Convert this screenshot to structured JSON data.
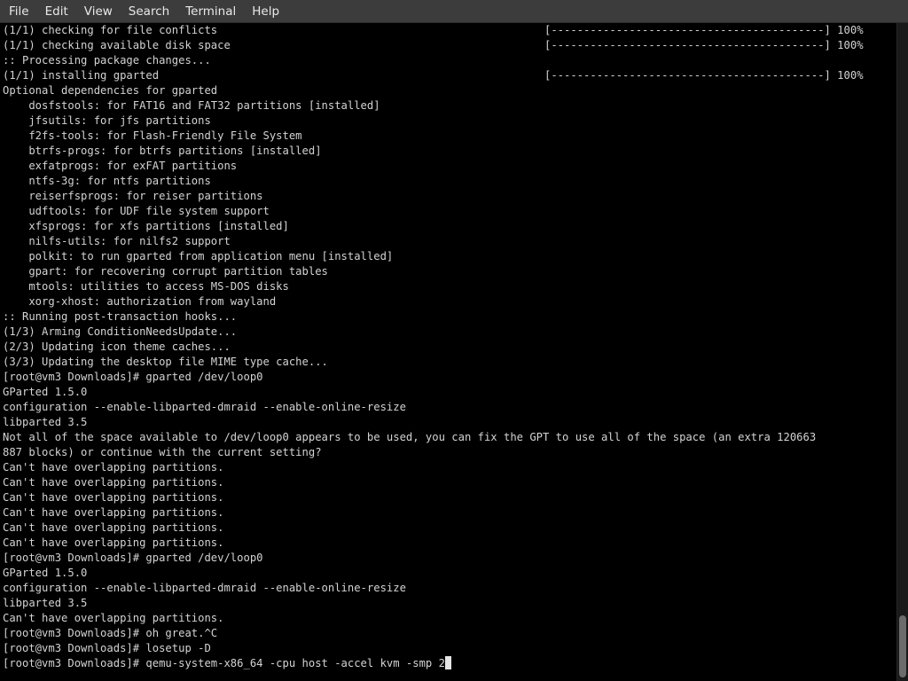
{
  "menu": [
    "File",
    "Edit",
    "View",
    "Search",
    "Terminal",
    "Help"
  ],
  "lines": [
    {
      "text": "(1/1) checking for file conflicts",
      "right": "[------------------------------------------] 100%"
    },
    {
      "text": "(1/1) checking available disk space",
      "right": "[------------------------------------------] 100%"
    },
    {
      "text": ":: Processing package changes..."
    },
    {
      "text": "(1/1) installing gparted",
      "right": "[------------------------------------------] 100%"
    },
    {
      "text": "Optional dependencies for gparted"
    },
    {
      "text": "    dosfstools: for FAT16 and FAT32 partitions [installed]"
    },
    {
      "text": "    jfsutils: for jfs partitions"
    },
    {
      "text": "    f2fs-tools: for Flash-Friendly File System"
    },
    {
      "text": "    btrfs-progs: for btrfs partitions [installed]"
    },
    {
      "text": "    exfatprogs: for exFAT partitions"
    },
    {
      "text": "    ntfs-3g: for ntfs partitions"
    },
    {
      "text": "    reiserfsprogs: for reiser partitions"
    },
    {
      "text": "    udftools: for UDF file system support"
    },
    {
      "text": "    xfsprogs: for xfs partitions [installed]"
    },
    {
      "text": "    nilfs-utils: for nilfs2 support"
    },
    {
      "text": "    polkit: to run gparted from application menu [installed]"
    },
    {
      "text": "    gpart: for recovering corrupt partition tables"
    },
    {
      "text": "    mtools: utilities to access MS-DOS disks"
    },
    {
      "text": "    xorg-xhost: authorization from wayland"
    },
    {
      "text": ":: Running post-transaction hooks..."
    },
    {
      "text": "(1/3) Arming ConditionNeedsUpdate..."
    },
    {
      "text": "(2/3) Updating icon theme caches..."
    },
    {
      "text": "(3/3) Updating the desktop file MIME type cache..."
    },
    {
      "text": "[root@vm3 Downloads]# gparted /dev/loop0"
    },
    {
      "text": "GParted 1.5.0"
    },
    {
      "text": "configuration --enable-libparted-dmraid --enable-online-resize"
    },
    {
      "text": "libparted 3.5"
    },
    {
      "text": "Not all of the space available to /dev/loop0 appears to be used, you can fix the GPT to use all of the space (an extra 120663"
    },
    {
      "text": "887 blocks) or continue with the current setting?"
    },
    {
      "text": "Can't have overlapping partitions."
    },
    {
      "text": "Can't have overlapping partitions."
    },
    {
      "text": "Can't have overlapping partitions."
    },
    {
      "text": "Can't have overlapping partitions."
    },
    {
      "text": "Can't have overlapping partitions."
    },
    {
      "text": "Can't have overlapping partitions."
    },
    {
      "text": "[root@vm3 Downloads]# gparted /dev/loop0"
    },
    {
      "text": "GParted 1.5.0"
    },
    {
      "text": "configuration --enable-libparted-dmraid --enable-online-resize"
    },
    {
      "text": "libparted 3.5"
    },
    {
      "text": "Can't have overlapping partitions."
    },
    {
      "text": "[root@vm3 Downloads]# oh great.^C"
    },
    {
      "text": "[root@vm3 Downloads]# losetup -D"
    },
    {
      "text": "[root@vm3 Downloads]# qemu-system-x86_64 -cpu host -accel kvm -smp 2",
      "cursor": true
    }
  ],
  "colors": {
    "background": "#000000",
    "text": "#d3d3d3",
    "menubar": "#3c3c3c",
    "menu_text": "#e8e8e8"
  }
}
